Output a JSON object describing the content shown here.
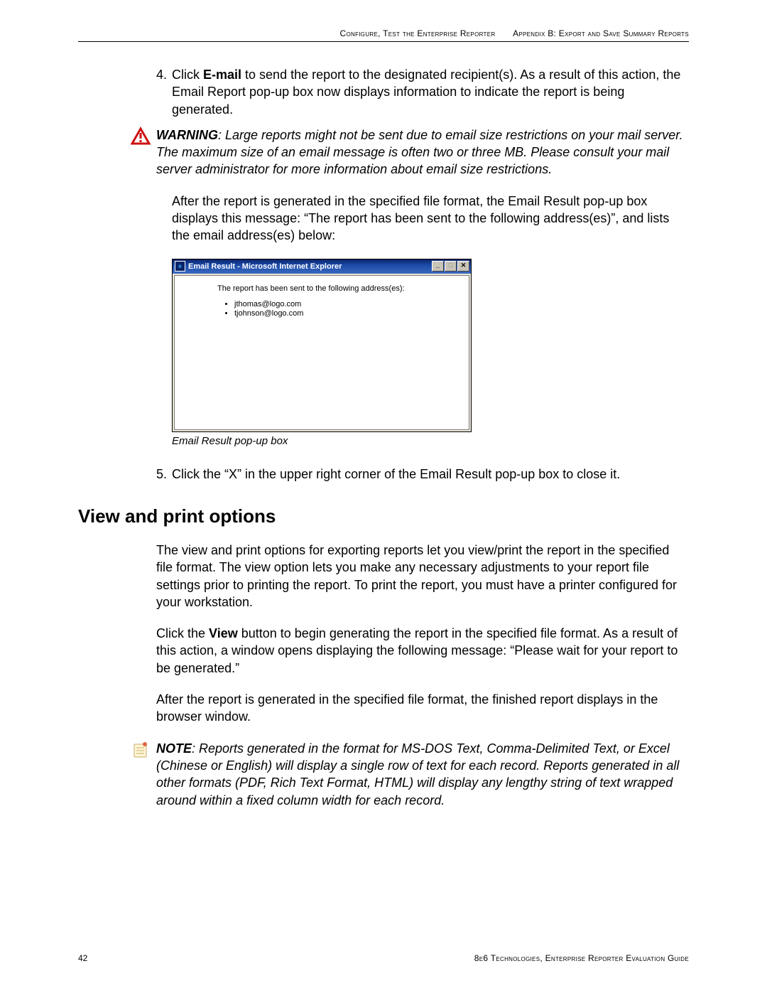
{
  "header": {
    "left": "Configure, Test the Enterprise Reporter",
    "right": "Appendix B: Export and Save Summary Reports"
  },
  "step4": {
    "num": "4.",
    "pre": "Click ",
    "bold": "E-mail",
    "post": " to send the report to the designated recipient(s). As a result of this action, the Email Report pop-up box now displays information to indicate the report is being generated."
  },
  "warning": {
    "lead": "WARNING",
    "text": ": Large reports might not be sent due to email size restrictions on your mail server. The maximum size of an email message is often two or three MB. Please consult your mail server administrator for more information about email size restrictions."
  },
  "after_para": "After the report is generated in the specified file format, the Email Result pop-up box displays this message: “The report has been sent to the following address(es)”, and lists the email address(es) below:",
  "popup": {
    "title": "Email Result - Microsoft Internet Explorer",
    "min": "_",
    "max": "□",
    "close": "✕",
    "msg": "The report has been sent to the following address(es):",
    "emails": [
      "jthomas@logo.com",
      "tjohnson@logo.com"
    ]
  },
  "caption": "Email Result pop-up box",
  "step5": {
    "num": "5.",
    "text": "Click the “X” in the upper right corner of the Email Result pop-up box to close it."
  },
  "section_heading": "View and print options",
  "view_p1": "The view and print options for exporting reports let you view/print the report in the specified file format. The view option lets you make any necessary adjustments to your report file settings prior to printing the report. To print the report, you must have a printer configured for your workstation.",
  "view_p2": {
    "pre": "Click the ",
    "bold": "View",
    "post": " button to begin generating the report in the specified file format. As a result of this action, a window opens displaying the following message: “Please wait for your report to be generated.”"
  },
  "view_p3": "After the report is generated in the specified file format, the finished report displays in the browser window.",
  "note": {
    "lead": "NOTE",
    "text": ": Reports generated in the format for MS-DOS Text, Comma-Delimited Text, or Excel (Chinese or English) will display a single row of text for each record. Reports generated in all other formats (PDF, Rich Text Format, HTML) will display any lengthy string of text wrapped around within a fixed column width for each record."
  },
  "footer": {
    "page": "42",
    "right": "8e6 Technologies, Enterprise Reporter Evaluation Guide"
  }
}
